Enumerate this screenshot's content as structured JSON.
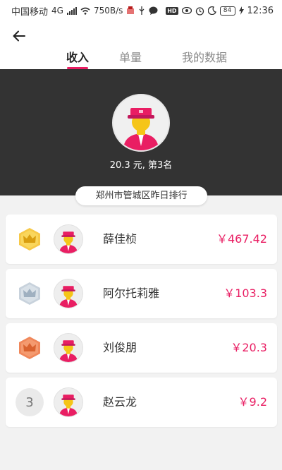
{
  "status_bar": {
    "carrier": "中国移动",
    "signal": "4G",
    "speed": "750B/s",
    "battery": "84",
    "time": "12:36"
  },
  "tabs": [
    {
      "label": "收入",
      "active": true
    },
    {
      "label": "单量",
      "active": false
    },
    {
      "label": "我的数据",
      "active": false
    }
  ],
  "hero": {
    "summary": "20.3 元, 第3名",
    "ranking_title": "郑州市管城区昨日排行"
  },
  "accent_color": "#e91e63",
  "leaderboard": [
    {
      "rank": "1",
      "badge": "gold-crown-badge",
      "name": "薛佳桢",
      "amount": "￥467.42"
    },
    {
      "rank": "2",
      "badge": "silver-crown-badge",
      "name": "阿尔托莉雅",
      "amount": "￥103.3"
    },
    {
      "rank": "3",
      "badge": "bronze-crown-badge",
      "name": "刘俊朋",
      "amount": "￥20.3"
    },
    {
      "rank": "3",
      "badge": "number",
      "name": "赵云龙",
      "amount": "￥9.2"
    }
  ]
}
